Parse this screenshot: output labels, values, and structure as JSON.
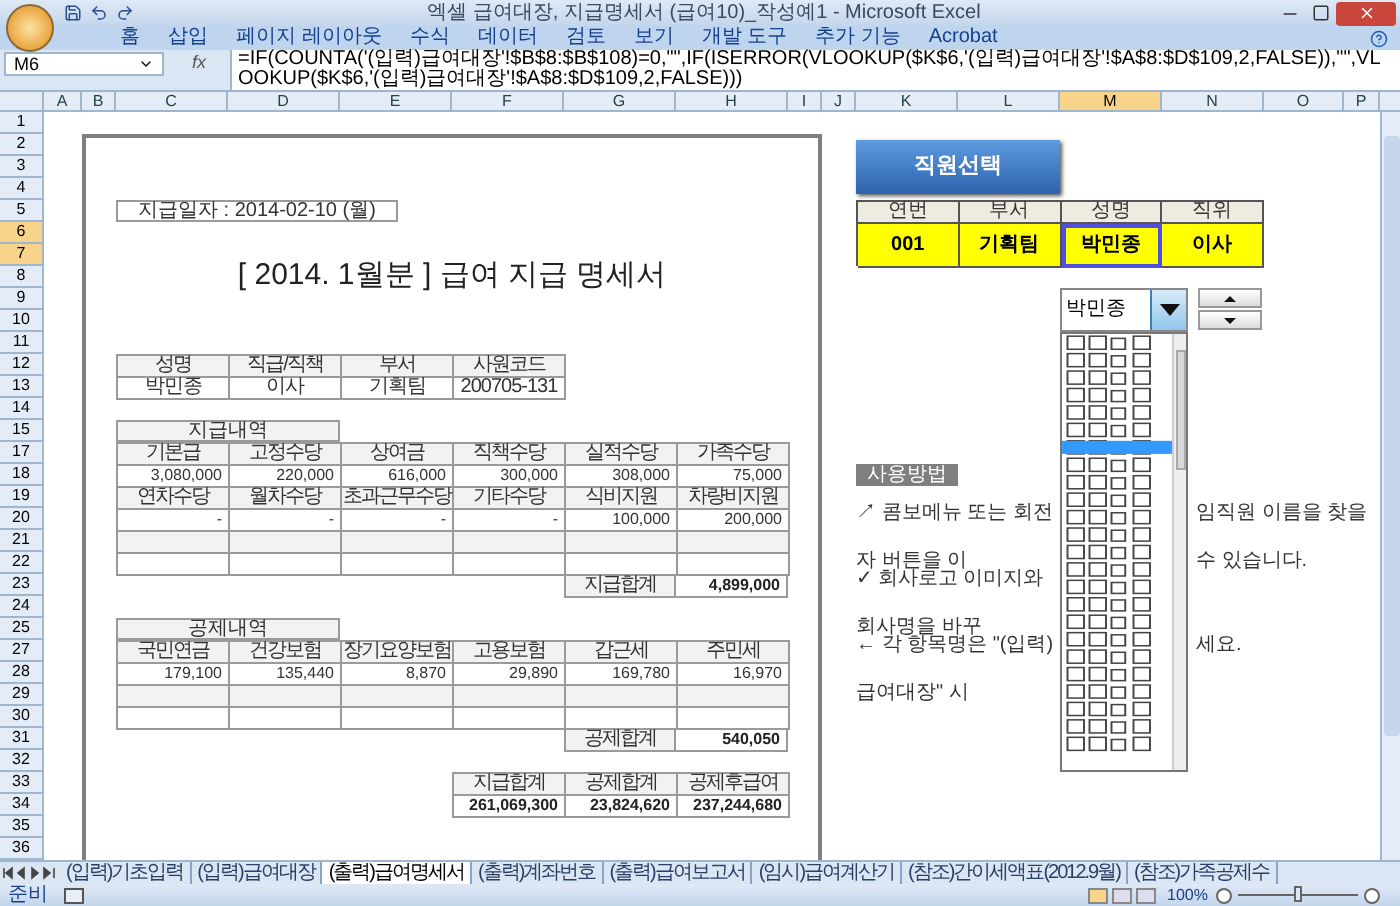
{
  "window": {
    "title": "엑셀 급여대장, 지급명세서 (급여10)_작성예1 - Microsoft Excel"
  },
  "ribbon_tabs": [
    "홈",
    "삽입",
    "페이지 레이아웃",
    "수식",
    "데이터",
    "검토",
    "보기",
    "개발 도구",
    "추가 기능",
    "Acrobat"
  ],
  "formula_bar": {
    "name_box": "M6",
    "function_label": "fx",
    "formula": "=IF(COUNTA('(입력)급여대장'!$B$8:$B$108)=0,\"\",IF(ISERROR(VLOOKUP($K$6,'(입력)급여대장'!$A$8:$D$109,2,FALSE)),\"\",VLOOKUP($K$6,'(입력)급여대장'!$A$8:$D$109,2,FALSE)))"
  },
  "columns": [
    {
      "label": "A",
      "selected": false
    },
    {
      "label": "B",
      "selected": false
    },
    {
      "label": "C",
      "selected": false
    },
    {
      "label": "D",
      "selected": false
    },
    {
      "label": "E",
      "selected": false
    },
    {
      "label": "F",
      "selected": false
    },
    {
      "label": "G",
      "selected": false
    },
    {
      "label": "H",
      "selected": false
    },
    {
      "label": "I",
      "selected": false
    },
    {
      "label": "J",
      "selected": false
    },
    {
      "label": "K",
      "selected": false
    },
    {
      "label": "L",
      "selected": false
    },
    {
      "label": "M",
      "selected": true
    },
    {
      "label": "N",
      "selected": false
    },
    {
      "label": "O",
      "selected": false
    },
    {
      "label": "P",
      "selected": false
    }
  ],
  "rows": [
    {
      "label": "1",
      "selected": false
    },
    {
      "label": "2",
      "selected": false
    },
    {
      "label": "3",
      "selected": false
    },
    {
      "label": "4",
      "selected": false
    },
    {
      "label": "5",
      "selected": false
    },
    {
      "label": "6",
      "selected": true
    },
    {
      "label": "7",
      "selected": true
    },
    {
      "label": "8",
      "selected": false
    },
    {
      "label": "9",
      "selected": false
    },
    {
      "label": "10",
      "selected": false
    },
    {
      "label": "11",
      "selected": false
    },
    {
      "label": "12",
      "selected": false
    },
    {
      "label": "13",
      "selected": false
    },
    {
      "label": "14",
      "selected": false
    },
    {
      "label": "15",
      "selected": false
    },
    {
      "label": "17",
      "selected": false
    },
    {
      "label": "18",
      "selected": false
    },
    {
      "label": "19",
      "selected": false
    },
    {
      "label": "20",
      "selected": false
    },
    {
      "label": "21",
      "selected": false
    },
    {
      "label": "22",
      "selected": false
    },
    {
      "label": "23",
      "selected": false
    },
    {
      "label": "24",
      "selected": false
    },
    {
      "label": "25",
      "selected": false
    },
    {
      "label": "27",
      "selected": false
    },
    {
      "label": "28",
      "selected": false
    },
    {
      "label": "29",
      "selected": false
    },
    {
      "label": "30",
      "selected": false
    },
    {
      "label": "31",
      "selected": false
    },
    {
      "label": "32",
      "selected": false
    },
    {
      "label": "33",
      "selected": false
    },
    {
      "label": "34",
      "selected": false
    },
    {
      "label": "35",
      "selected": false
    },
    {
      "label": "36",
      "selected": false
    }
  ],
  "payslip": {
    "date": "지급일자 : 2014-02-10 (월)",
    "title": "[ 2014. 1월분 ]  급여 지급 명세서",
    "employee": [
      {
        "kind": "header",
        "cells": [
          "성명",
          "직급/직책",
          "부서",
          "사원코드"
        ]
      },
      {
        "kind": "center",
        "cells": [
          "박민종",
          "이사",
          "기획팀",
          "200705-131"
        ]
      }
    ],
    "pay_section": "지급내역",
    "pay_rows": [
      {
        "kind": "header",
        "cells": [
          "기본급",
          "고정수당",
          "상여금",
          "직책수당",
          "실적수당",
          "가족수당"
        ]
      },
      {
        "kind": "value",
        "cells": [
          "3,080,000",
          "220,000",
          "616,000",
          "300,000",
          "308,000",
          "75,000"
        ]
      },
      {
        "kind": "header",
        "cells": [
          "연차수당",
          "월차수당",
          "초과근무수당",
          "기타수당",
          "식비지원",
          "차량비지원"
        ]
      },
      {
        "kind": "value",
        "cells": [
          "-",
          "-",
          "-",
          "-",
          "100,000",
          "200,000"
        ]
      },
      {
        "kind": "blank_shaded"
      },
      {
        "kind": "blank"
      }
    ],
    "pay_total": {
      "label": "지급합계",
      "value": "4,899,000"
    },
    "deduction_section": "공제내역",
    "deduction_rows": [
      {
        "kind": "header",
        "cells": [
          "국민연금",
          "건강보험",
          "장기요양보험",
          "고용보험",
          "갑근세",
          "주민세"
        ]
      },
      {
        "kind": "value",
        "cells": [
          "179,100",
          "135,440",
          "8,870",
          "29,890",
          "169,780",
          "16,970"
        ]
      },
      {
        "kind": "blank_shaded"
      },
      {
        "kind": "blank"
      }
    ],
    "deduction_total": {
      "label": "공제합계",
      "value": "540,050"
    },
    "summary": [
      {
        "kind": "header",
        "cells": [
          "지급합계",
          "공제합계",
          "공제후급여"
        ]
      },
      {
        "kind": "value_bold",
        "cells": [
          "261,069,300",
          "23,824,620",
          "237,244,680"
        ]
      }
    ]
  },
  "selector": {
    "button": "직원선택",
    "headers": [
      "연번",
      "부서",
      "성명",
      "직위"
    ],
    "values": [
      {
        "text": "001",
        "selected": false
      },
      {
        "text": "기획팀",
        "selected": false
      },
      {
        "text": "박민종",
        "selected": true
      },
      {
        "text": "이사",
        "selected": false
      }
    ],
    "combo_value": "박민종"
  },
  "usage": {
    "title": "사용방법",
    "lines": [
      {
        "left": "↗ 콤보메뉴 또는 회전자 버튼을 이",
        "right": "임직원 이름을 찾을 수 있습니다."
      },
      {
        "left": "✓ 회사로고 이미지와 회사명을 바꾸"
      },
      {
        "left": "← 각 항목명은 \"(입력)급여대장\" 시",
        "right": "세요."
      }
    ]
  },
  "sheet_tabs": [
    {
      "label": "(입력)기초입력",
      "selected": false
    },
    {
      "label": "(입력)급여대장",
      "selected": false
    },
    {
      "label": "(출력)급여명세서",
      "selected": true
    },
    {
      "label": "(출력)계좌번호",
      "selected": false
    },
    {
      "label": "(출력)급여보고서",
      "selected": false
    },
    {
      "label": "(임시)급여계산기",
      "selected": false
    },
    {
      "label": "(참조)간이세액표(2012.9월)",
      "selected": false
    },
    {
      "label": "(참조)가족공제수",
      "selected": false
    }
  ],
  "status_bar": {
    "status": "준비",
    "zoom": "100%",
    "zoom_slider": {
      "level": 0.5
    }
  }
}
